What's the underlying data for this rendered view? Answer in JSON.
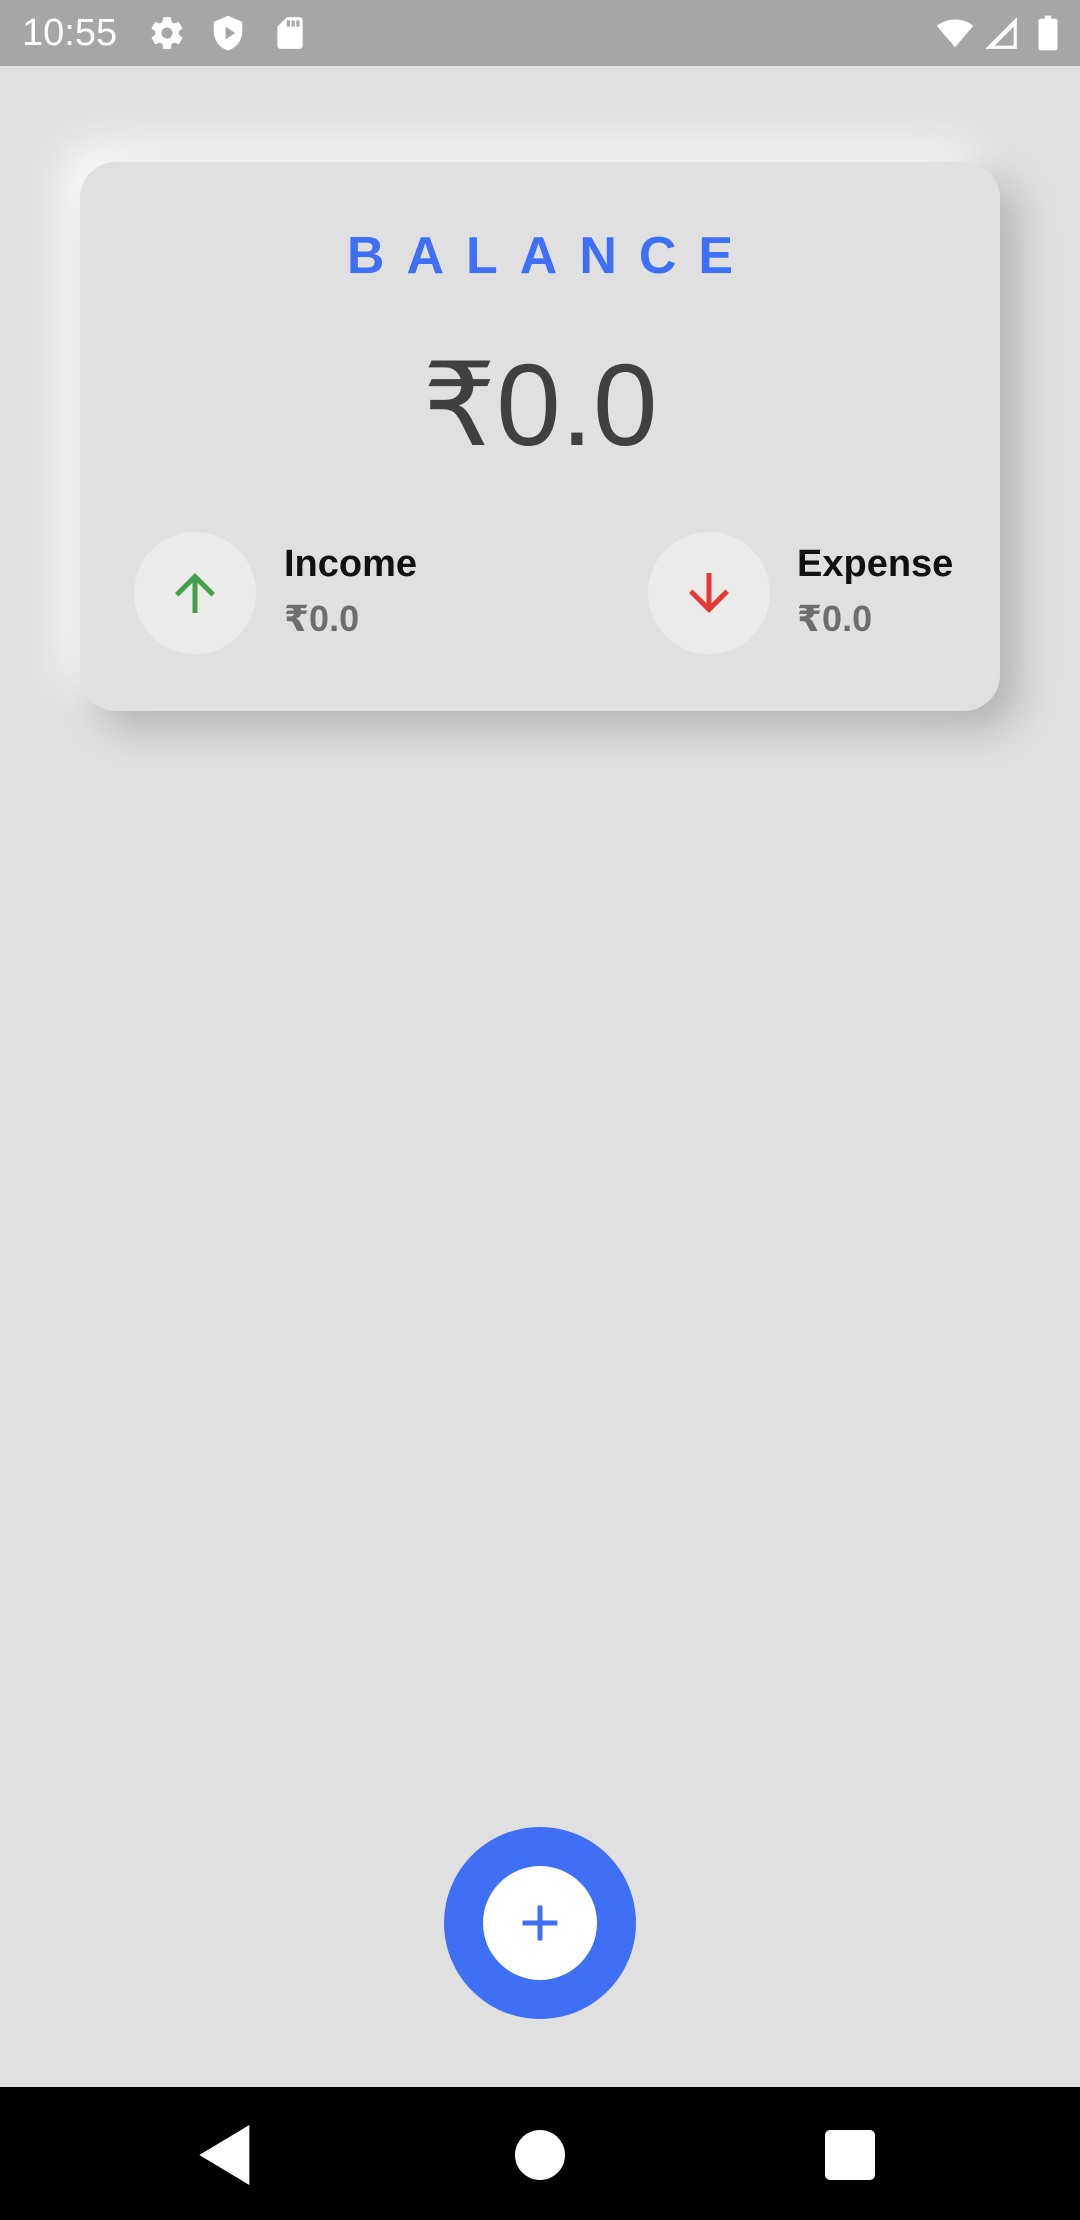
{
  "status_bar": {
    "time": "10:55",
    "icons_left": [
      "gear-icon",
      "shield-icon",
      "sd-card-icon"
    ],
    "icons_right": [
      "wifi-icon",
      "signal-icon",
      "battery-icon"
    ]
  },
  "balance_card": {
    "title": "BALANCE",
    "amount": "₹0.0",
    "income": {
      "label": "Income",
      "value": "₹0.0",
      "icon": "arrow-up-icon",
      "icon_color": "#43a047"
    },
    "expense": {
      "label": "Expense",
      "value": "₹0.0",
      "icon": "arrow-down-icon",
      "icon_color": "#e53935"
    }
  },
  "fab": {
    "icon": "plus-icon"
  },
  "nav_bar": {
    "buttons": [
      "back-icon",
      "home-icon",
      "recents-icon"
    ]
  },
  "colors": {
    "accent": "#3f6ff5",
    "background": "#e0e0e0",
    "status_bar": "#a6a6a6",
    "nav_bar": "#000000"
  }
}
